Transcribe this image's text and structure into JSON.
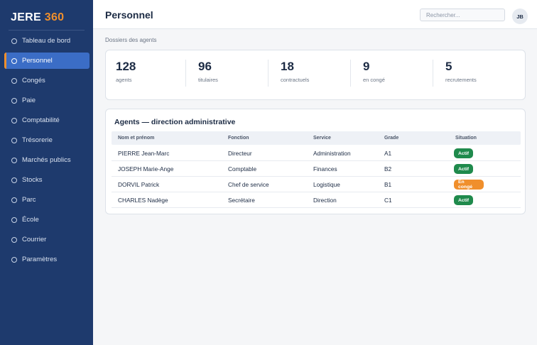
{
  "brand": {
    "part1": "JERE",
    "part2": "360"
  },
  "sidebar": {
    "items": [
      {
        "label": "Tableau de bord"
      },
      {
        "label": "Personnel",
        "active": true
      },
      {
        "label": "Congés"
      },
      {
        "label": "Paie"
      },
      {
        "label": "Comptabilité"
      },
      {
        "label": "Trésorerie"
      },
      {
        "label": "Marchés publics"
      },
      {
        "label": "Stocks"
      },
      {
        "label": "Parc"
      },
      {
        "label": "École"
      },
      {
        "label": "Courrier"
      },
      {
        "label": "Paramètres"
      }
    ]
  },
  "header": {
    "title": "Personnel",
    "search_placeholder": "Rechercher...",
    "avatar_initials": "JB"
  },
  "main": {
    "subtitle": "Dossiers des agents",
    "stats": [
      {
        "value": "128",
        "caption": "agents"
      },
      {
        "value": "96",
        "caption": "titulaires"
      },
      {
        "value": "18",
        "caption": "contractuels"
      },
      {
        "value": "9",
        "caption": "en congé"
      },
      {
        "value": "5",
        "caption": "recrutements"
      }
    ],
    "table": {
      "title": "Agents — direction administrative",
      "columns": [
        "Nom et prénom",
        "Fonction",
        "Service",
        "Grade",
        "Situation"
      ],
      "rows": [
        {
          "name": "PIERRE Jean-Marc",
          "function": "Directeur",
          "service": "Administration",
          "grade": "A1",
          "status": "Actif"
        },
        {
          "name": "JOSEPH Marie-Ange",
          "function": "Comptable",
          "service": "Finances",
          "grade": "B2",
          "status": "Actif"
        },
        {
          "name": "DORVIL Patrick",
          "function": "Chef de service",
          "service": "Logistique",
          "grade": "B1",
          "status": "En congé"
        },
        {
          "name": "CHARLES Nadège",
          "function": "Secrétaire",
          "service": "Direction",
          "grade": "C1",
          "status": "Actif"
        }
      ]
    }
  },
  "colors": {
    "sidebar_bg": "#1e3a6d",
    "accent": "#f08f2c",
    "active_nav": "#3b6dc6",
    "status_actif": "#1f8a4c",
    "status_conge": "#f08f2c"
  }
}
